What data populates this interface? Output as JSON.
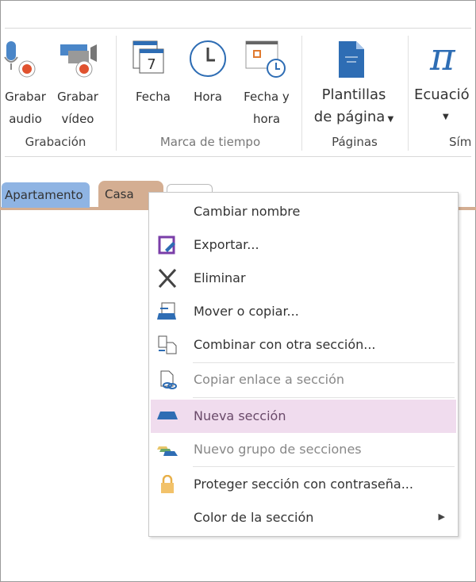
{
  "ribbon": {
    "buttons": [
      {
        "label1": "Grabar",
        "label2": "audio",
        "icon": "microphone-record-icon"
      },
      {
        "label1": "Grabar",
        "label2": "vídeo",
        "icon": "video-record-icon"
      },
      {
        "label1": "Fecha",
        "label2": "",
        "icon": "calendar-icon"
      },
      {
        "label1": "Hora",
        "label2": "",
        "icon": "clock-icon"
      },
      {
        "label1": "Fecha y",
        "label2": "hora",
        "icon": "calendar-clock-icon"
      },
      {
        "label1": "Plantillas",
        "label2": "de página",
        "icon": "page-template-icon"
      },
      {
        "label1": "Ecuació",
        "label2": "",
        "icon": "pi-icon"
      }
    ],
    "groups": [
      "Grabación",
      "Marca de tiempo",
      "Páginas",
      "Sím"
    ]
  },
  "tabs": [
    {
      "label": "Apartamento",
      "color": "#8fb4e3"
    },
    {
      "label": "Casa",
      "color": "#d4ae92"
    },
    {
      "label": ""
    }
  ],
  "menu": {
    "items": [
      {
        "label": "Cambiar nombre",
        "icon": "",
        "disabled": false
      },
      {
        "label": "Exportar...",
        "icon": "export-icon",
        "disabled": false
      },
      {
        "label": "Eliminar",
        "icon": "delete-x-icon",
        "disabled": false
      },
      {
        "label": "Mover o copiar...",
        "icon": "move-copy-icon",
        "disabled": false
      },
      {
        "label": "Combinar con otra sección...",
        "icon": "merge-icon",
        "disabled": false
      },
      {
        "label": "Copiar enlace a sección",
        "icon": "copy-link-icon",
        "disabled": true
      },
      {
        "label": "Nueva sección",
        "icon": "new-section-icon",
        "disabled": true,
        "highlighted": true
      },
      {
        "label": "Nuevo grupo de secciones",
        "icon": "new-section-group-icon",
        "disabled": true
      },
      {
        "label": "Proteger sección con contraseña...",
        "icon": "lock-icon",
        "disabled": false
      },
      {
        "label": "Color de la sección",
        "icon": "",
        "disabled": false,
        "submenu": true
      }
    ]
  },
  "colors": {
    "highlight": "#f0dcee",
    "accent": "#2e6db4",
    "record": "#e0522f"
  }
}
